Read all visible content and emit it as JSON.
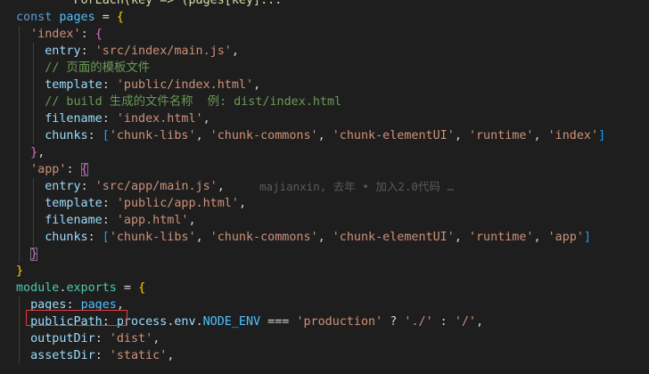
{
  "editor": {
    "colors": {
      "background": "#1e1e1e",
      "keyword": "#569cd6",
      "string": "#ce9178",
      "property": "#9cdcfe",
      "comment": "#6a9955",
      "highlight_box": "#e23a3a"
    },
    "blame": "majianxin, 去年 • 加入2.0代码 …",
    "lines": [
      {
        "y": 0,
        "tokens": [
          {
            "c": "fn",
            "t": "        ForEach(key => (pages[key]..."
          }
        ]
      },
      {
        "y": 1,
        "tokens": [
          {
            "c": "kw",
            "t": "const"
          },
          {
            "c": "punc",
            "t": " "
          },
          {
            "c": "cyan",
            "t": "pages"
          },
          {
            "c": "punc",
            "t": " = "
          },
          {
            "c": "gold",
            "t": "{"
          }
        ]
      },
      {
        "y": 2,
        "tokens": [
          {
            "c": "punc",
            "t": "  "
          },
          {
            "c": "str",
            "t": "'index'"
          },
          {
            "c": "punc",
            "t": ": "
          },
          {
            "c": "pink",
            "t": "{"
          }
        ]
      },
      {
        "y": 3,
        "tokens": [
          {
            "c": "punc",
            "t": "    "
          },
          {
            "c": "prop",
            "t": "entry"
          },
          {
            "c": "punc",
            "t": ": "
          },
          {
            "c": "str",
            "t": "'src/index/main.js'"
          },
          {
            "c": "punc",
            "t": ","
          }
        ]
      },
      {
        "y": 4,
        "tokens": [
          {
            "c": "punc",
            "t": "    "
          },
          {
            "c": "cmt",
            "t": "// 页面的模板文件"
          }
        ]
      },
      {
        "y": 5,
        "tokens": [
          {
            "c": "punc",
            "t": "    "
          },
          {
            "c": "prop",
            "t": "template"
          },
          {
            "c": "punc",
            "t": ": "
          },
          {
            "c": "str",
            "t": "'public/index.html'"
          },
          {
            "c": "punc",
            "t": ","
          }
        ]
      },
      {
        "y": 6,
        "tokens": [
          {
            "c": "punc",
            "t": "    "
          },
          {
            "c": "cmt",
            "t": "// build 生成的文件名称  例: dist/index.html"
          }
        ]
      },
      {
        "y": 7,
        "tokens": [
          {
            "c": "punc",
            "t": "    "
          },
          {
            "c": "prop",
            "t": "filename"
          },
          {
            "c": "punc",
            "t": ": "
          },
          {
            "c": "str",
            "t": "'index.html'"
          },
          {
            "c": "punc",
            "t": ","
          }
        ]
      },
      {
        "y": 8,
        "tokens": [
          {
            "c": "punc",
            "t": "    "
          },
          {
            "c": "prop",
            "t": "chunks"
          },
          {
            "c": "punc",
            "t": ": "
          },
          {
            "c": "sky",
            "t": "["
          },
          {
            "c": "str",
            "t": "'chunk-libs'"
          },
          {
            "c": "punc",
            "t": ", "
          },
          {
            "c": "str",
            "t": "'chunk-commons'"
          },
          {
            "c": "punc",
            "t": ", "
          },
          {
            "c": "str",
            "t": "'chunk-elementUI'"
          },
          {
            "c": "punc",
            "t": ", "
          },
          {
            "c": "str",
            "t": "'runtime'"
          },
          {
            "c": "punc",
            "t": ", "
          },
          {
            "c": "str",
            "t": "'index'"
          },
          {
            "c": "sky",
            "t": "]"
          }
        ]
      },
      {
        "y": 9,
        "tokens": [
          {
            "c": "punc",
            "t": "  "
          },
          {
            "c": "pink",
            "t": "}"
          },
          {
            "c": "punc",
            "t": ","
          }
        ]
      },
      {
        "y": 10,
        "tokens": [
          {
            "c": "punc",
            "t": "  "
          },
          {
            "c": "str",
            "t": "'app'"
          },
          {
            "c": "punc",
            "t": ": "
          },
          {
            "c": "pink bm",
            "t": "{"
          }
        ]
      },
      {
        "y": 11,
        "blame": true,
        "tokens": [
          {
            "c": "punc",
            "t": "    "
          },
          {
            "c": "prop",
            "t": "entry"
          },
          {
            "c": "punc",
            "t": ": "
          },
          {
            "c": "str",
            "t": "'src/app/main.js'"
          },
          {
            "c": "punc",
            "t": ","
          }
        ]
      },
      {
        "y": 12,
        "tokens": [
          {
            "c": "punc",
            "t": "    "
          },
          {
            "c": "prop",
            "t": "template"
          },
          {
            "c": "punc",
            "t": ": "
          },
          {
            "c": "str",
            "t": "'public/app.html'"
          },
          {
            "c": "punc",
            "t": ","
          }
        ]
      },
      {
        "y": 13,
        "tokens": [
          {
            "c": "punc",
            "t": "    "
          },
          {
            "c": "prop",
            "t": "filename"
          },
          {
            "c": "punc",
            "t": ": "
          },
          {
            "c": "str",
            "t": "'app.html'"
          },
          {
            "c": "punc",
            "t": ","
          }
        ]
      },
      {
        "y": 14,
        "tokens": [
          {
            "c": "punc",
            "t": "    "
          },
          {
            "c": "prop",
            "t": "chunks"
          },
          {
            "c": "punc",
            "t": ": "
          },
          {
            "c": "sky",
            "t": "["
          },
          {
            "c": "str",
            "t": "'chunk-libs'"
          },
          {
            "c": "punc",
            "t": ", "
          },
          {
            "c": "str",
            "t": "'chunk-commons'"
          },
          {
            "c": "punc",
            "t": ", "
          },
          {
            "c": "str",
            "t": "'chunk-elementUI'"
          },
          {
            "c": "punc",
            "t": ", "
          },
          {
            "c": "str",
            "t": "'runtime'"
          },
          {
            "c": "punc",
            "t": ", "
          },
          {
            "c": "str",
            "t": "'app'"
          },
          {
            "c": "sky",
            "t": "]"
          }
        ]
      },
      {
        "y": 15,
        "tokens": [
          {
            "c": "punc",
            "t": "  "
          },
          {
            "c": "pink bm",
            "t": "}"
          }
        ]
      },
      {
        "y": 16,
        "tokens": [
          {
            "c": "gold",
            "t": "}"
          }
        ]
      },
      {
        "y": 17,
        "tokens": [
          {
            "c": "cls",
            "t": "module"
          },
          {
            "c": "punc",
            "t": "."
          },
          {
            "c": "cls",
            "t": "exports"
          },
          {
            "c": "punc",
            "t": " = "
          },
          {
            "c": "gold",
            "t": "{"
          }
        ]
      },
      {
        "y": 18,
        "tokens": [
          {
            "c": "punc",
            "t": "  "
          },
          {
            "c": "prop",
            "t": "pages"
          },
          {
            "c": "punc",
            "t": ": "
          },
          {
            "c": "cyan",
            "t": "pages"
          },
          {
            "c": "punc",
            "t": ","
          }
        ]
      },
      {
        "y": 19,
        "tokens": [
          {
            "c": "punc",
            "t": "  "
          },
          {
            "c": "prop",
            "t": "publicPath"
          },
          {
            "c": "punc",
            "t": ": "
          },
          {
            "c": "prop",
            "t": "process"
          },
          {
            "c": "punc",
            "t": "."
          },
          {
            "c": "prop",
            "t": "env"
          },
          {
            "c": "punc",
            "t": "."
          },
          {
            "c": "cyan",
            "t": "NODE_ENV"
          },
          {
            "c": "punc",
            "t": " === "
          },
          {
            "c": "str",
            "t": "'production'"
          },
          {
            "c": "punc",
            "t": " ? "
          },
          {
            "c": "str",
            "t": "'./'"
          },
          {
            "c": "punc",
            "t": " : "
          },
          {
            "c": "str",
            "t": "'/'"
          },
          {
            "c": "punc",
            "t": ","
          }
        ]
      },
      {
        "y": 20,
        "tokens": [
          {
            "c": "punc",
            "t": "  "
          },
          {
            "c": "prop",
            "t": "outputDir"
          },
          {
            "c": "punc",
            "t": ": "
          },
          {
            "c": "str",
            "t": "'dist'"
          },
          {
            "c": "punc",
            "t": ","
          }
        ]
      },
      {
        "y": 21,
        "tokens": [
          {
            "c": "punc",
            "t": "  "
          },
          {
            "c": "prop",
            "t": "assetsDir"
          },
          {
            "c": "punc",
            "t": ": "
          },
          {
            "c": "str",
            "t": "'static'"
          },
          {
            "c": "punc",
            "t": ","
          }
        ]
      }
    ]
  }
}
